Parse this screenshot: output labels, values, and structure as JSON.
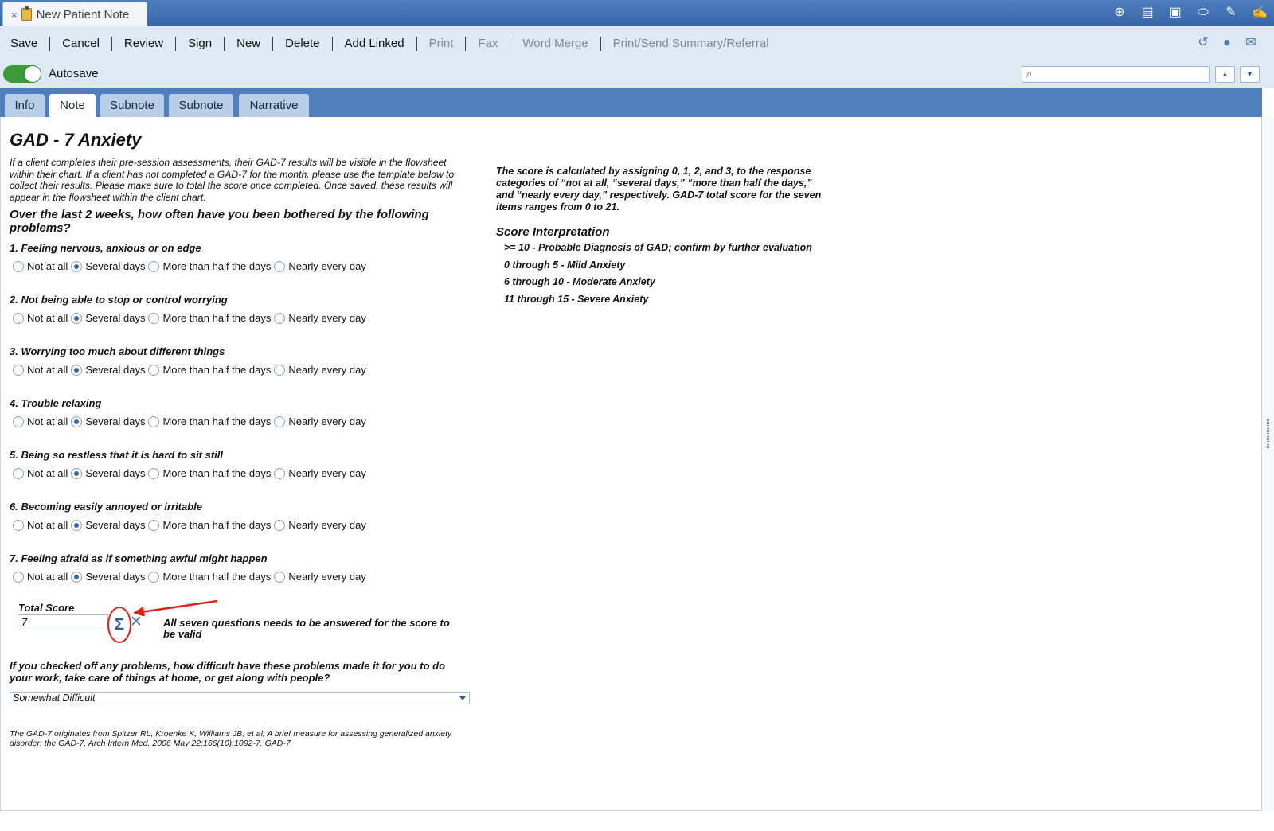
{
  "window": {
    "tab_close": "×",
    "tab_title": "New Patient Note"
  },
  "title_icons": [
    "globe-icon",
    "book-icon",
    "clipboard-icon",
    "pill-icon",
    "pen-icon",
    "sign-pen-icon"
  ],
  "toolbar": {
    "items": [
      {
        "label": "Save",
        "enabled": true
      },
      {
        "label": "Cancel",
        "enabled": true
      },
      {
        "label": "Review",
        "enabled": true
      },
      {
        "label": "Sign",
        "enabled": true
      },
      {
        "label": "New",
        "enabled": true
      },
      {
        "label": "Delete",
        "enabled": true
      },
      {
        "label": "Add Linked",
        "enabled": true
      },
      {
        "label": "Print",
        "enabled": false
      },
      {
        "label": "Fax",
        "enabled": false
      },
      {
        "label": "Word Merge",
        "enabled": false
      },
      {
        "label": "Print/Send Summary/Referral",
        "enabled": false
      }
    ]
  },
  "autosave": {
    "label": "Autosave",
    "on": true
  },
  "search": {
    "placeholder": "",
    "value": ""
  },
  "tabs": [
    {
      "label": "Info",
      "active": false
    },
    {
      "label": "Note",
      "active": true
    },
    {
      "label": "Subnote",
      "active": false
    },
    {
      "label": "Subnote",
      "active": false
    },
    {
      "label": "Narrative",
      "active": false
    }
  ],
  "form": {
    "title": "GAD - 7 Anxiety",
    "intro": "If a client completes their pre-session assessments, their GAD-7 results will be visible in the flowsheet within their chart. If a client has not completed a GAD-7 for the month, please use the template below to collect their results. Please make sure to total the score once completed. Once saved, these results will appear in the flowsheet within the client chart.",
    "question_heading": "Over the last 2 weeks, how often have you been bothered by the following problems?",
    "options": [
      "Not at all",
      "Several days",
      "More than half the days",
      "Nearly every day"
    ],
    "questions": [
      {
        "label": "1. Feeling nervous, anxious or on edge",
        "selected": 1
      },
      {
        "label": "2. Not being able to stop or control worrying",
        "selected": 1
      },
      {
        "label": "3. Worrying too much about different things",
        "selected": 1
      },
      {
        "label": "4. Trouble relaxing",
        "selected": 1
      },
      {
        "label": "5. Being so restless that it is hard to sit still",
        "selected": 1
      },
      {
        "label": "6. Becoming easily annoyed or irritable",
        "selected": 1
      },
      {
        "label": "7. Feeling afraid as if something awful might happen",
        "selected": 1
      }
    ],
    "total_score_label": "Total Score",
    "total_score_value": "7",
    "sum_symbol": "Σ",
    "clear_symbol": "✕",
    "score_note": "All seven questions needs to be answered for the score to be valid",
    "difficulty_question": "If you checked off any problems, how difficult have these problems made it for you to do your work, take care of things at home, or get along with people?",
    "difficulty_value": "Somewhat Difficult",
    "citation": "The GAD-7 originates from Spitzer RL, Kroenke K, Williams JB, et al; A brief measure for assessing generalized anxiety disorder: the GAD-7. Arch Intern Med. 2006 May 22;166(10):1092-7. GAD-7"
  },
  "scoring": {
    "calc_note": "The score is calculated by assigning 0, 1, 2, and 3, to the response categories of “not at all, “several days,” “more than half the days,” and “nearly every day,” respectively. GAD-7 total score for the seven items ranges from 0 to 21.",
    "interpretation_title": "Score Interpretation",
    "interpretation": [
      ">= 10 - Probable Diagnosis of GAD; confirm by further evaluation",
      "0 through 5 - Mild Anxiety",
      "6 through 10 - Moderate Anxiety",
      "11 through 15 - Severe Anxiety"
    ]
  },
  "colors": {
    "accent": "#4f7fbd",
    "toolbar_bg": "#dfe9f3",
    "annotation": "#e0201b"
  }
}
